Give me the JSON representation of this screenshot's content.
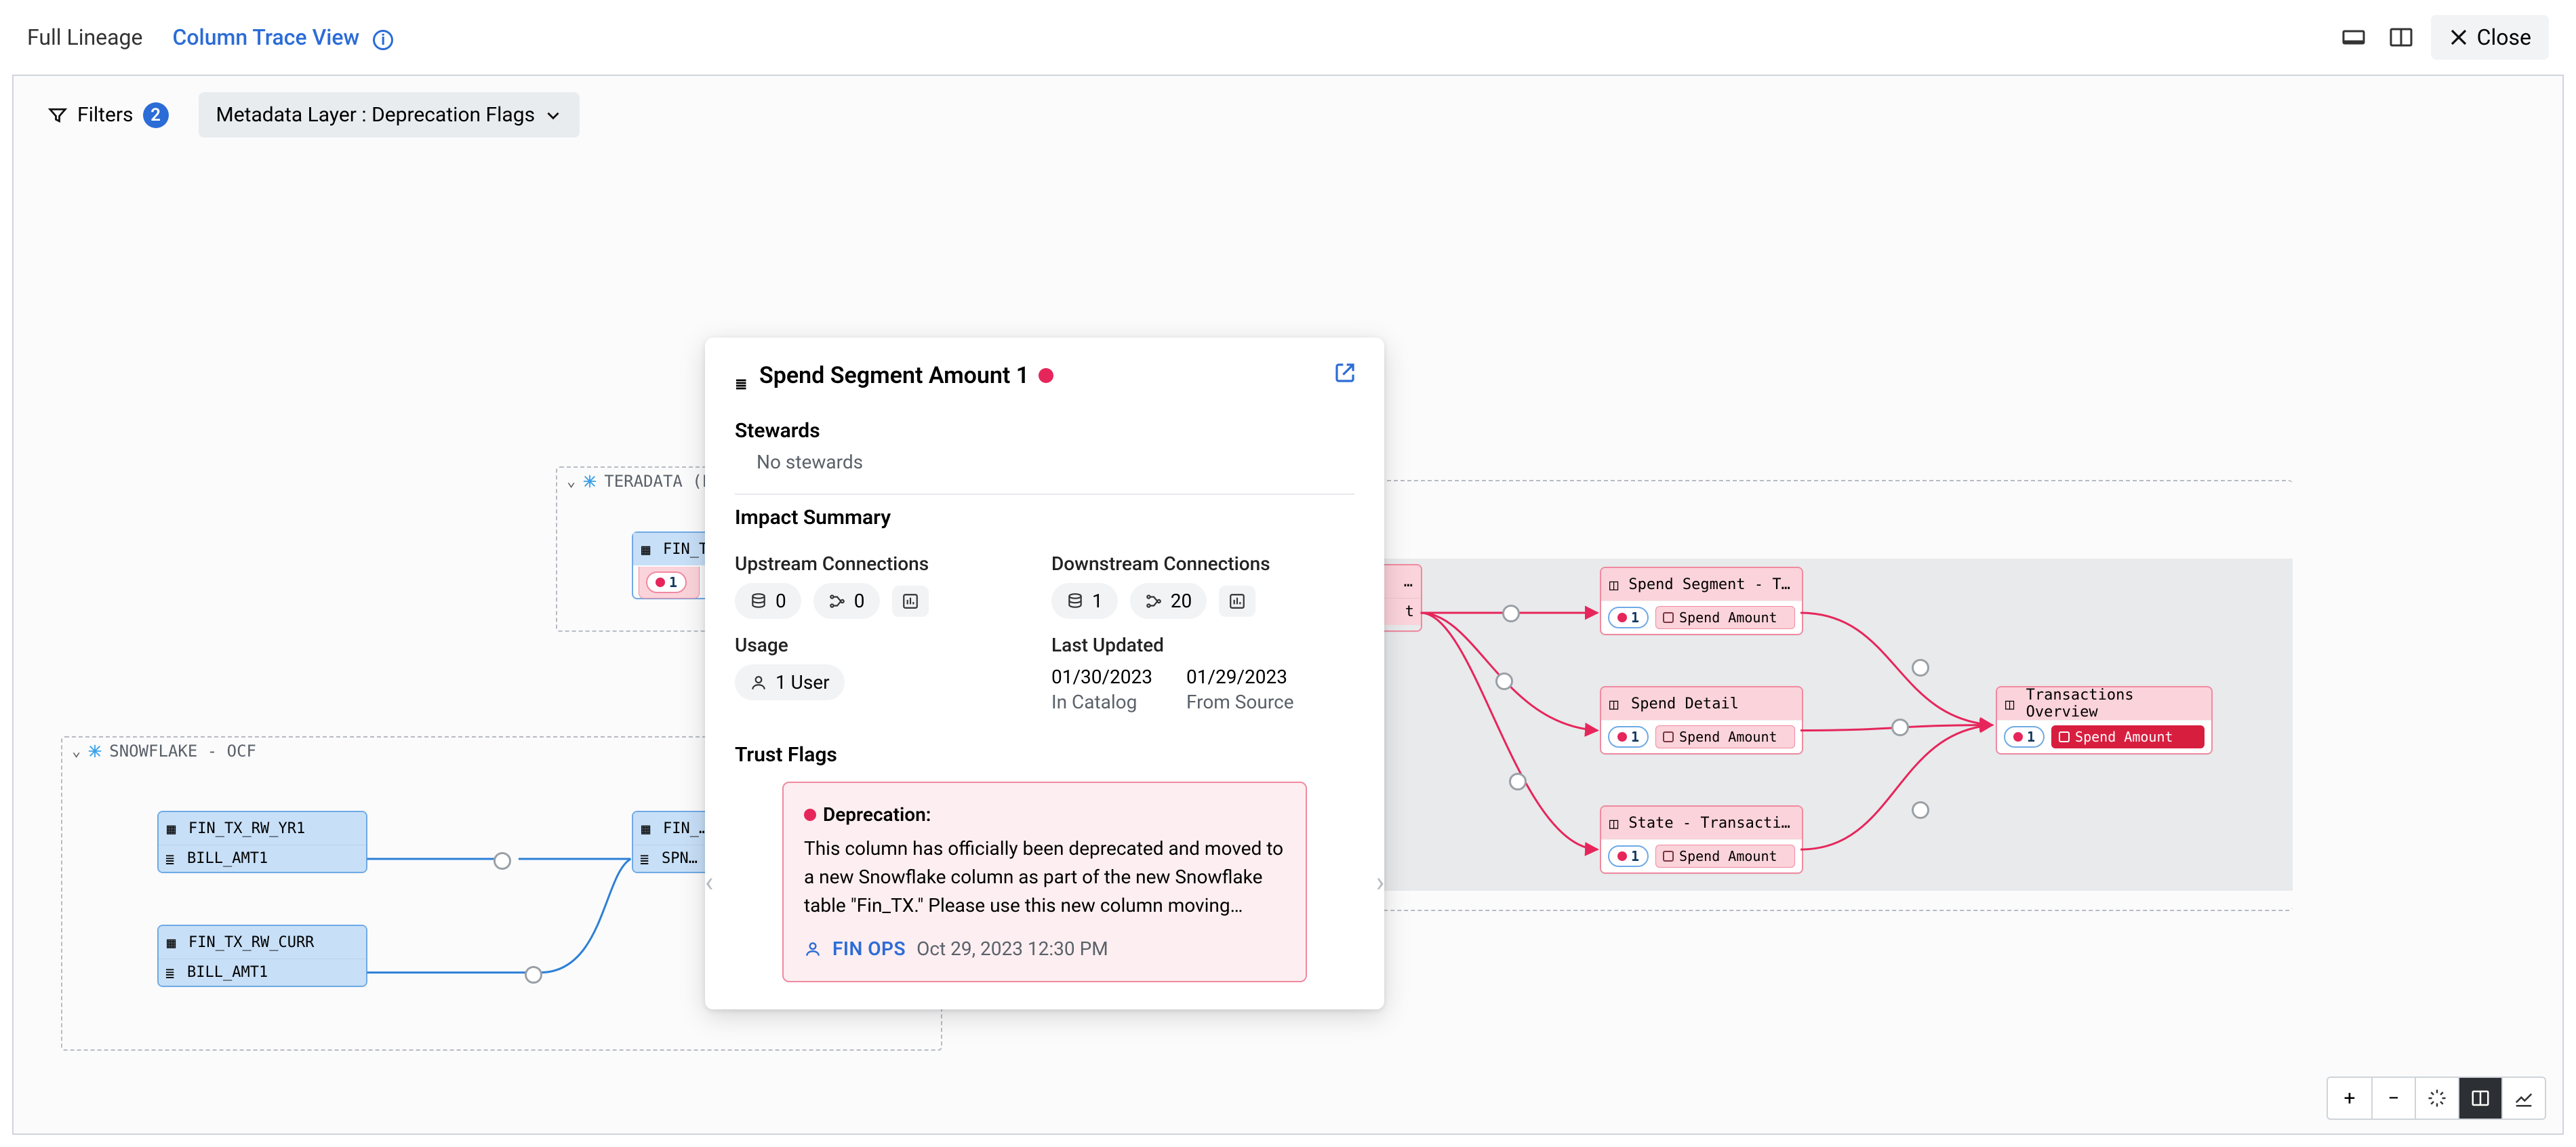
{
  "header": {
    "tab_full": "Full Lineage",
    "tab_trace": "Column Trace View",
    "close_label": "Close"
  },
  "toolbar": {
    "filters_label": "Filters",
    "filters_count": "2",
    "metadata_layer_label": "Metadata Layer : Deprecation Flags"
  },
  "groups": {
    "teradata": {
      "title": "TERADATA (LEGA…"
    },
    "snowflake": {
      "title": "SNOWFLAKE - OCF"
    }
  },
  "nodes": {
    "fin_tx_legacy": {
      "name": "FIN_T…",
      "pill_count": "1"
    },
    "fin_tx_rw_yr1": {
      "name": "FIN_TX_RW_YR1",
      "col": "BILL_AMT1"
    },
    "fin_tx_rw_curr": {
      "name": "FIN_TX_RW_CURR",
      "col": "BILL_AMT1"
    },
    "fin_snow": {
      "name": "FIN_…",
      "col": "SPN…"
    },
    "spend_segment_tra": {
      "header": "Spend Segment - Tra...",
      "pill_count": "1",
      "col": "Spend Amount"
    },
    "spend_detail": {
      "header": "Spend Detail",
      "pill_count": "1",
      "col": "Spend Amount"
    },
    "state_transaction": {
      "header": "State - Transaction...",
      "pill_count": "1",
      "col": "Spend Amount"
    },
    "transactions_overview": {
      "header": "Transactions Overview",
      "pill_count": "1",
      "col": "Spend Amount"
    }
  },
  "edge_label": "t",
  "popover": {
    "title": "Spend Segment Amount 1",
    "stewards_heading": "Stewards",
    "stewards_value": "No stewards",
    "impact_heading": "Impact Summary",
    "upstream_label": "Upstream Connections",
    "downstream_label": "Downstream Connections",
    "upstream_db": "0",
    "upstream_flow": "0",
    "downstream_db": "1",
    "downstream_flow": "20",
    "usage_label": "Usage",
    "usage_value": "1 User",
    "last_updated_label": "Last Updated",
    "date_catalog": "01/30/2023",
    "date_catalog_sub": "In Catalog",
    "date_source": "01/29/2023",
    "date_source_sub": "From Source",
    "trust_heading": "Trust Flags",
    "trust_title": "Deprecation:",
    "trust_body": "This column has officially been deprecated and moved to a new Snowflake column as part of the new Snowflake table \"Fin_TX.\" Please use this new column moving…",
    "trust_author": "FIN OPS",
    "trust_date": "Oct 29, 2023 12:30 PM"
  }
}
